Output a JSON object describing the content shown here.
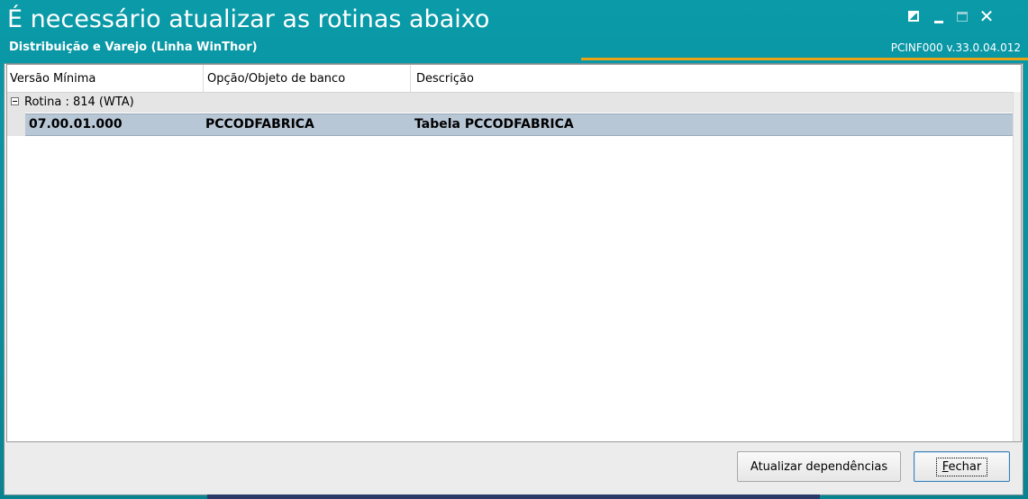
{
  "window": {
    "title": "É necessário atualizar as rotinas abaixo",
    "subtitle": "Distribuição e Varejo (Linha WinThor)",
    "version": "PCINF000  v.33.0.04.012",
    "accent_color": "#e8a317",
    "titlebar_color": "#0a9aa8",
    "controls": [
      "restore-icon",
      "minimize-icon",
      "maximize-icon",
      "close-icon"
    ],
    "close_glyph": "✕"
  },
  "grid": {
    "columns": [
      "Versão Mínima",
      "Opção/Objeto de banco",
      "Descrição"
    ],
    "groups": [
      {
        "label": "Rotina : 814 (WTA)",
        "rows": [
          {
            "versao": "07.00.01.000",
            "objeto": "PCCODFABRICA",
            "descricao": "Tabela PCCODFABRICA"
          }
        ]
      }
    ],
    "selected_row_color": "#b8c7d6"
  },
  "buttons": {
    "atualizar": "Atualizar dependências",
    "fechar_first": "F",
    "fechar_rest": "echar"
  }
}
